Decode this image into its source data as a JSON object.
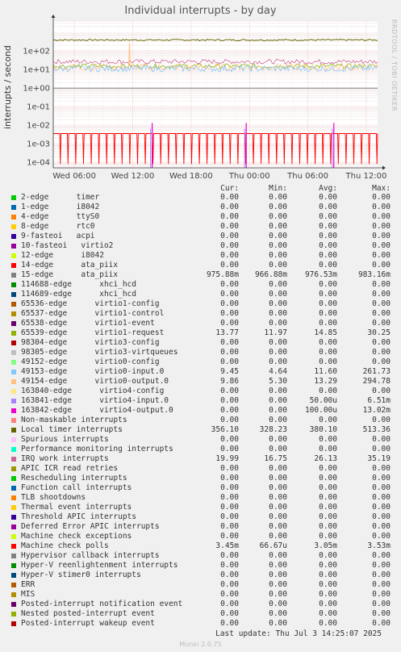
{
  "chart_data": {
    "type": "line",
    "title": "Individual interrupts - by day",
    "side_label": "RRDTOOL / TOBI OETIKER",
    "ylabel": "interrupts / second",
    "yscale": "log",
    "ylim": [
      5e-05,
      4000
    ],
    "y_ticks": [
      "1e+02",
      "1e+01",
      "1e+00",
      "1e-01",
      "1e-02",
      "1e-03",
      "1e-04"
    ],
    "x_ticks": [
      "Wed 06:00",
      "Wed 12:00",
      "Wed 18:00",
      "Thu 00:00",
      "Thu 06:00",
      "Thu 12:00"
    ],
    "grid": true,
    "columns": [
      "Cur:",
      "Min:",
      "Avg:",
      "Max:"
    ],
    "series": [
      {
        "name": "2-edge      timer",
        "color": "#00cc00",
        "values": [
          "0.00",
          "0.00",
          "0.00",
          "0.00"
        ]
      },
      {
        "name": "1-edge      i8042",
        "color": "#0066b3",
        "values": [
          "0.00",
          "0.00",
          "0.00",
          "0.00"
        ]
      },
      {
        "name": "4-edge      ttyS0",
        "color": "#ff8000",
        "values": [
          "0.00",
          "0.00",
          "0.00",
          "0.00"
        ]
      },
      {
        "name": "8-edge      rtc0",
        "color": "#ffcc00",
        "values": [
          "0.00",
          "0.00",
          "0.00",
          "0.00"
        ]
      },
      {
        "name": "9-fasteoi   acpi",
        "color": "#330099",
        "values": [
          "0.00",
          "0.00",
          "0.00",
          "0.00"
        ]
      },
      {
        "name": "10-fasteoi   virtio2",
        "color": "#990099",
        "values": [
          "0.00",
          "0.00",
          "0.00",
          "0.00"
        ]
      },
      {
        "name": "12-edge      i8042",
        "color": "#ccff00",
        "values": [
          "0.00",
          "0.00",
          "0.00",
          "0.00"
        ]
      },
      {
        "name": "14-edge      ata_piix",
        "color": "#ff0000",
        "values": [
          "0.00",
          "0.00",
          "0.00",
          "0.00"
        ]
      },
      {
        "name": "15-edge      ata_piix",
        "color": "#808080",
        "values": [
          "975.88m",
          "966.88m",
          "976.53m",
          "983.16m"
        ]
      },
      {
        "name": "114688-edge      xhci_hcd",
        "color": "#008f00",
        "values": [
          "0.00",
          "0.00",
          "0.00",
          "0.00"
        ]
      },
      {
        "name": "114689-edge      xhci_hcd",
        "color": "#00487d",
        "values": [
          "0.00",
          "0.00",
          "0.00",
          "0.00"
        ]
      },
      {
        "name": "65536-edge      virtio1-config",
        "color": "#b35a00",
        "values": [
          "0.00",
          "0.00",
          "0.00",
          "0.00"
        ]
      },
      {
        "name": "65537-edge      virtio1-control",
        "color": "#b38f00",
        "values": [
          "0.00",
          "0.00",
          "0.00",
          "0.00"
        ]
      },
      {
        "name": "65538-edge      virtio1-event",
        "color": "#6b006b",
        "values": [
          "0.00",
          "0.00",
          "0.00",
          "0.00"
        ]
      },
      {
        "name": "65539-edge      virtio1-request",
        "color": "#8fb300",
        "values": [
          "13.77",
          "11.97",
          "14.85",
          "30.25"
        ]
      },
      {
        "name": "98304-edge      virtio3-config",
        "color": "#b30000",
        "values": [
          "0.00",
          "0.00",
          "0.00",
          "0.00"
        ]
      },
      {
        "name": "98305-edge      virtio3-virtqueues",
        "color": "#bebebe",
        "values": [
          "0.00",
          "0.00",
          "0.00",
          "0.00"
        ]
      },
      {
        "name": "49152-edge      virtio0-config",
        "color": "#80ff80",
        "values": [
          "0.00",
          "0.00",
          "0.00",
          "0.00"
        ]
      },
      {
        "name": "49153-edge      virtio0-input.0",
        "color": "#80c9ff",
        "values": [
          "9.45",
          "4.64",
          "11.60",
          "261.73"
        ]
      },
      {
        "name": "49154-edge      virtio0-output.0",
        "color": "#ffc080",
        "values": [
          "9.86",
          "5.30",
          "13.29",
          "294.78"
        ]
      },
      {
        "name": "163840-edge      virtio4-config",
        "color": "#ffe680",
        "values": [
          "0.00",
          "0.00",
          "0.00",
          "0.00"
        ]
      },
      {
        "name": "163841-edge      virtio4-input.0",
        "color": "#aa80ff",
        "values": [
          "0.00",
          "0.00",
          "50.00u",
          "6.51m"
        ]
      },
      {
        "name": "163842-edge      virtio4-output.0",
        "color": "#ee00cc",
        "values": [
          "0.00",
          "0.00",
          "100.00u",
          "13.02m"
        ]
      },
      {
        "name": "Non-maskable interrupts",
        "color": "#ff8080",
        "values": [
          "0.00",
          "0.00",
          "0.00",
          "0.00"
        ]
      },
      {
        "name": "Local timer interrupts",
        "color": "#666600",
        "values": [
          "356.10",
          "328.23",
          "380.10",
          "513.36"
        ]
      },
      {
        "name": "Spurious interrupts",
        "color": "#ffbfff",
        "values": [
          "0.00",
          "0.00",
          "0.00",
          "0.00"
        ]
      },
      {
        "name": "Performance monitoring interrupts",
        "color": "#00ffcc",
        "values": [
          "0.00",
          "0.00",
          "0.00",
          "0.00"
        ]
      },
      {
        "name": "IRQ work interrupts",
        "color": "#cc6699",
        "values": [
          "19.99",
          "16.75",
          "26.13",
          "35.19"
        ]
      },
      {
        "name": "APIC ICR read retries",
        "color": "#999900",
        "values": [
          "0.00",
          "0.00",
          "0.00",
          "0.00"
        ]
      },
      {
        "name": "Rescheduling interrupts",
        "color": "#00cc00",
        "values": [
          "0.00",
          "0.00",
          "0.00",
          "0.00"
        ]
      },
      {
        "name": "Function call interrupts",
        "color": "#0066b3",
        "values": [
          "0.00",
          "0.00",
          "0.00",
          "0.00"
        ]
      },
      {
        "name": "TLB shootdowns",
        "color": "#ff8000",
        "values": [
          "0.00",
          "0.00",
          "0.00",
          "0.00"
        ]
      },
      {
        "name": "Thermal event interrupts",
        "color": "#ffcc00",
        "values": [
          "0.00",
          "0.00",
          "0.00",
          "0.00"
        ]
      },
      {
        "name": "Threshold APIC interrupts",
        "color": "#330099",
        "values": [
          "0.00",
          "0.00",
          "0.00",
          "0.00"
        ]
      },
      {
        "name": "Deferred Error APIC interrupts",
        "color": "#990099",
        "values": [
          "0.00",
          "0.00",
          "0.00",
          "0.00"
        ]
      },
      {
        "name": "Machine check exceptions",
        "color": "#ccff00",
        "values": [
          "0.00",
          "0.00",
          "0.00",
          "0.00"
        ]
      },
      {
        "name": "Machine check polls",
        "color": "#ff0000",
        "values": [
          "3.45m",
          "66.67u",
          "3.05m",
          "3.53m"
        ]
      },
      {
        "name": "Hypervisor callback interrupts",
        "color": "#808080",
        "values": [
          "0.00",
          "0.00",
          "0.00",
          "0.00"
        ]
      },
      {
        "name": "Hyper-V reenlightenment interrupts",
        "color": "#008f00",
        "values": [
          "0.00",
          "0.00",
          "0.00",
          "0.00"
        ]
      },
      {
        "name": "Hyper-V stimer0 interrupts",
        "color": "#00487d",
        "values": [
          "0.00",
          "0.00",
          "0.00",
          "0.00"
        ]
      },
      {
        "name": "ERR",
        "color": "#b35a00",
        "values": [
          "0.00",
          "0.00",
          "0.00",
          "0.00"
        ]
      },
      {
        "name": "MIS",
        "color": "#b38f00",
        "values": [
          "0.00",
          "0.00",
          "0.00",
          "0.00"
        ]
      },
      {
        "name": "Posted-interrupt notification event",
        "color": "#6b006b",
        "values": [
          "0.00",
          "0.00",
          "0.00",
          "0.00"
        ]
      },
      {
        "name": "Nested posted-interrupt event",
        "color": "#8fb300",
        "values": [
          "0.00",
          "0.00",
          "0.00",
          "0.00"
        ]
      },
      {
        "name": "Posted-interrupt wakeup event",
        "color": "#b30000",
        "values": [
          "0.00",
          "0.00",
          "0.00",
          "0.00"
        ]
      }
    ],
    "last_update": "Last update: Thu Jul  3 14:25:07 2025",
    "footer": "Munin 2.0.75"
  }
}
